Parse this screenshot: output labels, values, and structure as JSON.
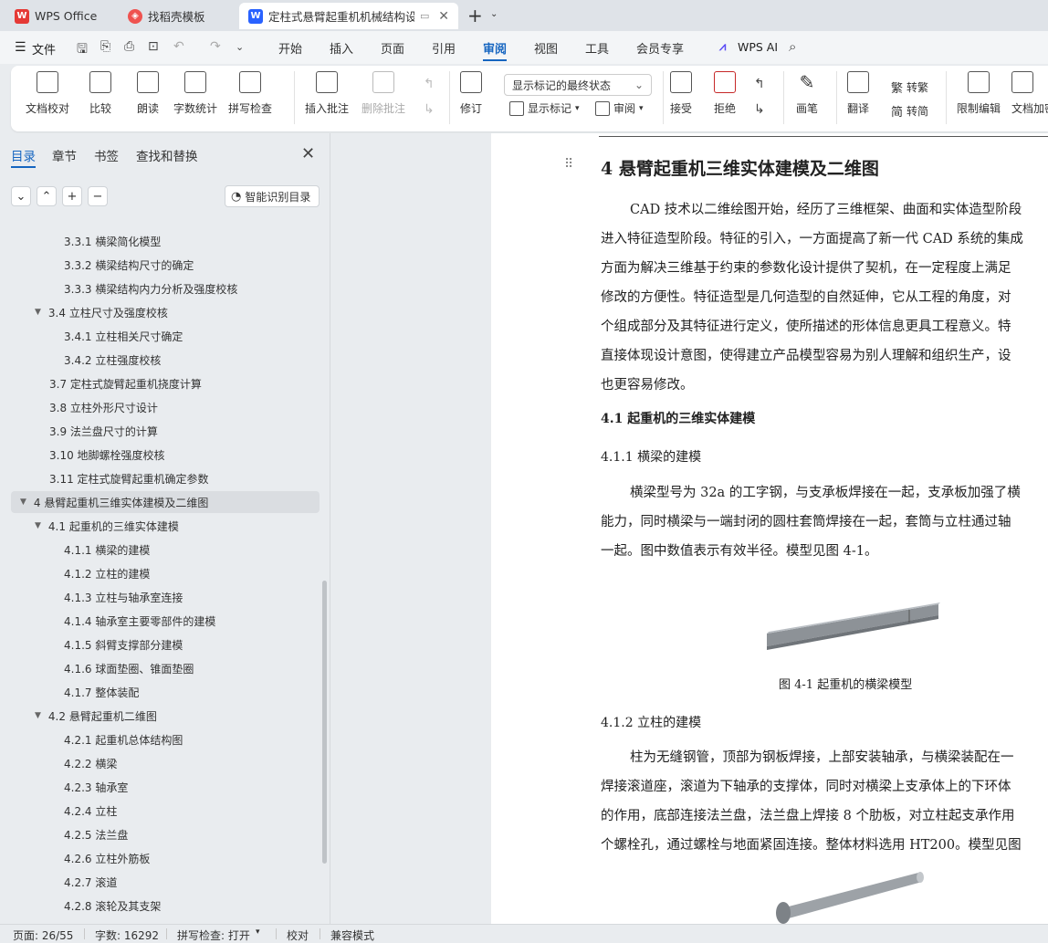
{
  "tabs": [
    {
      "label": "WPS Office"
    },
    {
      "label": "找稻壳模板"
    },
    {
      "label": "定柱式悬臂起重机机械结构设计"
    }
  ],
  "menu": {
    "file": "文件",
    "items": [
      "开始",
      "插入",
      "页面",
      "引用",
      "审阅",
      "视图",
      "工具",
      "会员专享"
    ],
    "active": "审阅",
    "wps_ai": "WPS AI"
  },
  "ribbon": {
    "buttons": [
      "文档校对",
      "比较",
      "朗读",
      "字数统计",
      "拼写检查",
      "插入批注",
      "删除批注",
      "修订",
      "接受",
      "拒绝",
      "画笔",
      "翻译",
      "限制编辑",
      "文档加密"
    ],
    "markup_select": "显示标记的最终状态",
    "show_markup": "显示标记",
    "review": "审阅",
    "to_traditional": "转繁",
    "to_simplified": "转简"
  },
  "sidebar": {
    "tabs": [
      "目录",
      "章节",
      "书签",
      "查找和替换"
    ],
    "smart_toc": "智能识别目录",
    "toc": [
      {
        "label": "3.3.1 横梁简化模型",
        "level": 3
      },
      {
        "label": "3.3.2 横梁结构尺寸的确定",
        "level": 3
      },
      {
        "label": "3.3.3 横梁结构内力分析及强度校核",
        "level": 3
      },
      {
        "label": "3.4 立柱尺寸及强度校核",
        "level": 2,
        "expanded": true
      },
      {
        "label": "3.4.1 立柱相关尺寸确定",
        "level": 3
      },
      {
        "label": "3.4.2 立柱强度校核",
        "level": 3
      },
      {
        "label": "3.7 定柱式旋臂起重机挠度计算",
        "level": 2
      },
      {
        "label": "3.8 立柱外形尺寸设计",
        "level": 2
      },
      {
        "label": "3.9 法兰盘尺寸的计算",
        "level": 2
      },
      {
        "label": "3.10 地脚螺栓强度校核",
        "level": 2
      },
      {
        "label": "3.11  定柱式旋臂起重机确定参数",
        "level": 2
      },
      {
        "label": "4   悬臂起重机三维实体建模及二维图",
        "level": 1,
        "expanded": true,
        "selected": true
      },
      {
        "label": "4.1   起重机的三维实体建模",
        "level": 2,
        "expanded": true
      },
      {
        "label": "4.1.1  横梁的建模",
        "level": 3
      },
      {
        "label": "4.1.2  立柱的建模",
        "level": 3
      },
      {
        "label": "4.1.3 立柱与轴承室连接",
        "level": 3
      },
      {
        "label": "4.1.4 轴承室主要零部件的建模",
        "level": 3
      },
      {
        "label": "4.1.5  斜臂支撑部分建模",
        "level": 3
      },
      {
        "label": "4.1.6  球面垫圈、锥面垫圈",
        "level": 3
      },
      {
        "label": "4.1.7  整体装配",
        "level": 3
      },
      {
        "label": "4.2   悬臂起重机二维图",
        "level": 2,
        "expanded": true
      },
      {
        "label": "4.2.1 起重机总体结构图",
        "level": 3
      },
      {
        "label": "4.2.2 横梁",
        "level": 3
      },
      {
        "label": "4.2.3 轴承室",
        "level": 3
      },
      {
        "label": "4.2.4 立柱",
        "level": 3
      },
      {
        "label": "4.2.5 法兰盘",
        "level": 3
      },
      {
        "label": "4.2.6 立柱外筋板",
        "level": 3
      },
      {
        "label": "4.2.7 滚道",
        "level": 3
      },
      {
        "label": "4.2.8 滚轮及其支架",
        "level": 3
      }
    ]
  },
  "document": {
    "heading1": "4   悬臂起重机三维实体建模及二维图",
    "para1": [
      "CAD 技术以二维绘图开始，经历了三维框架、曲面和实体造型阶段",
      "进入特征造型阶段。特征的引入，一方面提高了新一代 CAD 系统的集成",
      "方面为解决三维基于约束的参数化设计提供了契机，在一定程度上满足",
      "修改的方便性。特征造型是几何造型的自然延伸，它从工程的角度，对",
      "个组成部分及其特征进行定义，使所描述的形体信息更具工程意义。特",
      "直接体现设计意图，使得建立产品模型容易为别人理解和组织生产，设",
      "也更容易修改。"
    ],
    "heading2": "4.1   起重机的三维实体建模",
    "heading3a": "4.1.1 横梁的建模",
    "para2": [
      "横梁型号为 32a 的工字钢，与支承板焊接在一起，支承板加强了横",
      "能力，同时横梁与一端封闭的圆柱套筒焊接在一起，套筒与立柱通过轴",
      "一起。图中数值表示有效半径。模型见图 4-1。"
    ],
    "caption": "图 4-1   起重机的横梁模型",
    "heading3b": "4.1.2 立柱的建模",
    "para3": [
      "柱为无缝钢管，顶部为钢板焊接，上部安装轴承，与横梁装配在一",
      "焊接滚道座，滚道为下轴承的支撑体，同时对横梁上支承体上的下环体",
      "的作用，底部连接法兰盘，法兰盘上焊接 8 个肋板，对立柱起支承作用",
      "个螺栓孔，通过螺栓与地面紧固连接。整体材料选用 HT200。模型见图"
    ]
  },
  "status": {
    "page": "页面: 26/55",
    "words": "字数: 16292",
    "spell": "拼写检查: 打开",
    "proof": "校对",
    "compat": "兼容模式"
  }
}
